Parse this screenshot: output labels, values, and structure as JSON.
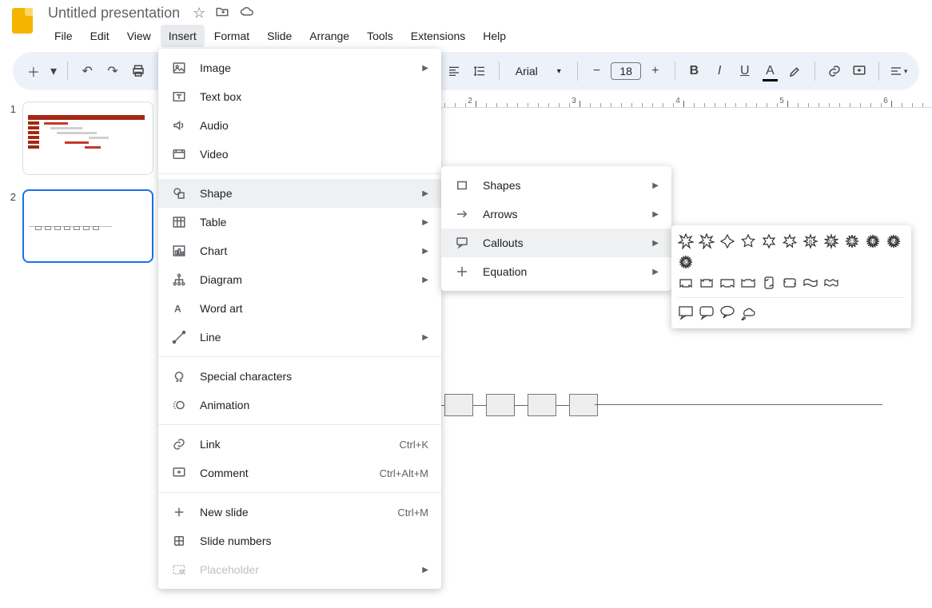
{
  "header": {
    "title": "Untitled presentation",
    "menus": [
      "File",
      "Edit",
      "View",
      "Insert",
      "Format",
      "Slide",
      "Arrange",
      "Tools",
      "Extensions",
      "Help"
    ],
    "active_menu": "Insert"
  },
  "toolbar": {
    "font_family": "Arial",
    "font_size": "18"
  },
  "slides": [
    {
      "number": "1"
    },
    {
      "number": "2"
    }
  ],
  "ruler_labels": [
    "2",
    "3",
    "4",
    "5",
    "6"
  ],
  "insert_menu": {
    "items": [
      {
        "icon": "image",
        "label": "Image",
        "submenu": true
      },
      {
        "icon": "textbox",
        "label": "Text box"
      },
      {
        "icon": "audio",
        "label": "Audio"
      },
      {
        "icon": "video",
        "label": "Video"
      },
      {
        "sep": true
      },
      {
        "icon": "shape",
        "label": "Shape",
        "submenu": true,
        "highlight": true
      },
      {
        "icon": "table",
        "label": "Table",
        "submenu": true
      },
      {
        "icon": "chart",
        "label": "Chart",
        "submenu": true
      },
      {
        "icon": "diagram",
        "label": "Diagram",
        "submenu": true
      },
      {
        "icon": "wordart",
        "label": "Word art"
      },
      {
        "icon": "line",
        "label": "Line",
        "submenu": true
      },
      {
        "sep": true
      },
      {
        "icon": "special",
        "label": "Special characters"
      },
      {
        "icon": "animation",
        "label": "Animation"
      },
      {
        "sep": true
      },
      {
        "icon": "link",
        "label": "Link",
        "shortcut": "Ctrl+K"
      },
      {
        "icon": "comment",
        "label": "Comment",
        "shortcut": "Ctrl+Alt+M"
      },
      {
        "sep": true
      },
      {
        "icon": "newslide",
        "label": "New slide",
        "shortcut": "Ctrl+M"
      },
      {
        "icon": "slidenum",
        "label": "Slide numbers"
      },
      {
        "icon": "placeholder",
        "label": "Placeholder",
        "submenu": true,
        "disabled": true
      }
    ]
  },
  "shape_submenu": {
    "items": [
      {
        "icon": "shapes",
        "label": "Shapes",
        "submenu": true
      },
      {
        "icon": "arrows",
        "label": "Arrows",
        "submenu": true
      },
      {
        "icon": "callouts",
        "label": "Callouts",
        "submenu": true,
        "highlight": true
      },
      {
        "icon": "equation",
        "label": "Equation",
        "submenu": true
      }
    ]
  },
  "callouts": {
    "row1": [
      "explosion1",
      "explosion2",
      "star4",
      "star5",
      "star6",
      "star7",
      "star8",
      "star10",
      "star12",
      "star16",
      "star24",
      "star32"
    ],
    "row2": [
      "ribbon-up",
      "ribbon-down",
      "ribbon2-up",
      "ribbon2-down",
      "scroll-v",
      "scroll-h",
      "wave",
      "double-wave"
    ],
    "row3": [
      "rect-callout",
      "round-rect-callout",
      "oval-callout",
      "cloud-callout"
    ]
  }
}
